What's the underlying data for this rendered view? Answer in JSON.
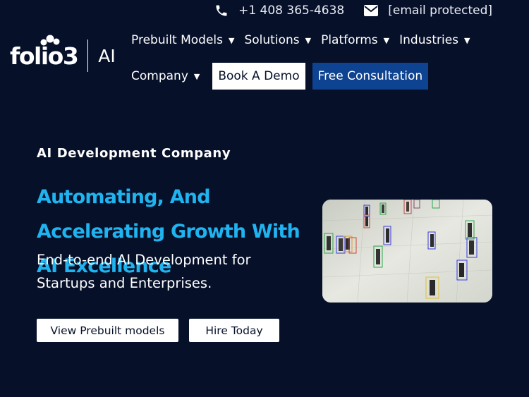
{
  "topbar": {
    "phone_icon": "phone-icon",
    "phone": "+1 408 365-4638",
    "email_icon": "envelope-icon",
    "email": "[email protected]"
  },
  "logo": {
    "wordmark": "folio3",
    "suffix": "AI"
  },
  "nav": {
    "row1": [
      {
        "label": "Prebuilt Models"
      },
      {
        "label": "Solutions"
      },
      {
        "label": "Platforms"
      },
      {
        "label": "Industries"
      }
    ],
    "row2": [
      {
        "label": "Company"
      }
    ],
    "caret": "▼",
    "book_demo": "Book A Demo",
    "free_consultation": "Free Consultation"
  },
  "hero": {
    "eyebrow": "AI Development Company",
    "title": "Automating, And Accelerating Growth With AI Excellence",
    "subtitle": "End-to-end AI Development for Startups and Enterprises.",
    "button_prebuilt": "View Prebuilt models",
    "button_hire": "Hire Today"
  },
  "colors": {
    "background": "#061029",
    "accent_blue": "#1fb4f0",
    "consult_button": "#0d4390"
  }
}
